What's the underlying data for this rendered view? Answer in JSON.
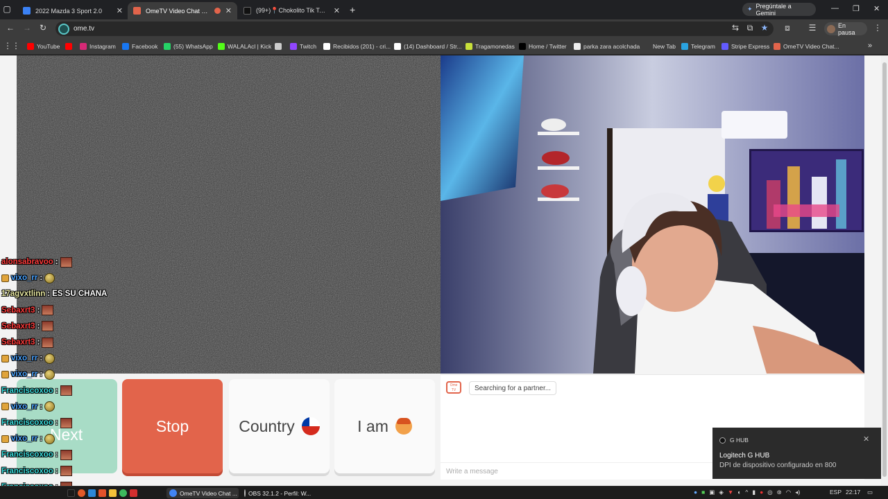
{
  "tabs": [
    {
      "title": "2022 Mazda 3 Sport 2.0",
      "color": "#3b82f6",
      "active": false
    },
    {
      "title": "OmeTV Video Chat — Ome",
      "color": "#e2644b",
      "active": true
    },
    {
      "title": "(99+)📍Chokolito Tik Tok 📍 c",
      "color": "#111111",
      "active": false
    }
  ],
  "browser": {
    "new_tab": "+",
    "gemini_label": "Pregúntale a Gemini",
    "url": "ome.tv",
    "profile_label": "En pausa",
    "back_icon": "←",
    "forward_icon": "→",
    "reload_icon": "↻",
    "menu_icon": "⋮"
  },
  "bookmarks": [
    {
      "label": "YouTube",
      "color": "#ff0000"
    },
    {
      "label": "",
      "color": "#ff0000"
    },
    {
      "label": "Instagram",
      "color": "#d62976"
    },
    {
      "label": "Facebook",
      "color": "#1877f2"
    },
    {
      "label": "(55) WhatsApp",
      "color": "#25d366"
    },
    {
      "label": "WALALAcl | Kick",
      "color": "#53fc18"
    },
    {
      "label": "",
      "color": "#cccccc"
    },
    {
      "label": "Twitch",
      "color": "#9146ff"
    },
    {
      "label": "Recibidos (201) - cri...",
      "color": "#ffffff"
    },
    {
      "label": "(14) Dashboard / Str...",
      "color": "#ffffff"
    },
    {
      "label": "Tragamonedas",
      "color": "#c8e03a"
    },
    {
      "label": "Home / Twitter",
      "color": "#000000"
    },
    {
      "label": "parka zara acolchada",
      "color": "#eeeeee"
    },
    {
      "label": "New Tab",
      "color": "#3c3c3c"
    },
    {
      "label": "Telegram",
      "color": "#2aa3e0"
    },
    {
      "label": "Stripe Express",
      "color": "#635bff"
    },
    {
      "label": "OmeTV Video Chat...",
      "color": "#e2644b"
    }
  ],
  "bookmarks_more": "»",
  "controls": {
    "next": "Next",
    "stop": "Stop",
    "country": "Country",
    "iam": "I am"
  },
  "chat": {
    "logo": "Ome TV",
    "searching": "Searching for a partner...",
    "placeholder": "Write a message"
  },
  "overlay_chat": [
    {
      "user": "alonsabravoo",
      "color": "#ff3b3b",
      "badge": false,
      "emote": "face",
      "text": ""
    },
    {
      "user": "vixo_rr",
      "color": "#4aa3ff",
      "badge": true,
      "emote": "coin",
      "text": ""
    },
    {
      "user": "17agvxtlinn",
      "color": "#e6e6a0",
      "badge": false,
      "emote": "",
      "text": "ES SU CHANA"
    },
    {
      "user": "Sebaxrt3",
      "color": "#ff3b3b",
      "badge": false,
      "emote": "face",
      "text": ""
    },
    {
      "user": "Sebaxrt3",
      "color": "#ff3b3b",
      "badge": false,
      "emote": "face",
      "text": ""
    },
    {
      "user": "Sebaxrt3",
      "color": "#ff3b3b",
      "badge": false,
      "emote": "face",
      "text": ""
    },
    {
      "user": "vixo_rr",
      "color": "#4aa3ff",
      "badge": true,
      "emote": "coin",
      "text": ""
    },
    {
      "user": "vixo_rr",
      "color": "#4aa3ff",
      "badge": true,
      "emote": "coin",
      "text": ""
    },
    {
      "user": "Franciscoxoo",
      "color": "#38d9d9",
      "badge": false,
      "emote": "face",
      "text": ""
    },
    {
      "user": "vixo_rr",
      "color": "#4aa3ff",
      "badge": true,
      "emote": "coin",
      "text": ""
    },
    {
      "user": "Franciscoxoo",
      "color": "#38d9d9",
      "badge": false,
      "emote": "face",
      "text": ""
    },
    {
      "user": "vixo_rr",
      "color": "#4aa3ff",
      "badge": true,
      "emote": "coin",
      "text": ""
    },
    {
      "user": "Franciscoxoo",
      "color": "#38d9d9",
      "badge": false,
      "emote": "face",
      "text": ""
    },
    {
      "user": "Franciscoxoo",
      "color": "#38d9d9",
      "badge": false,
      "emote": "face",
      "text": ""
    },
    {
      "user": "Franciscoxoo",
      "color": "#38d9d9",
      "badge": false,
      "emote": "face",
      "text": ""
    }
  ],
  "notification": {
    "app": "G HUB",
    "title": "Logitech G HUB",
    "body": "DPI de dispositivo configurado en 800",
    "close": "✕"
  },
  "taskbar": {
    "apps": [
      {
        "label": "OmeTV Video Chat ...",
        "color": "#4285f4"
      },
      {
        "label": "OBS 32.1.2 - Perfil: W...",
        "color": "#302e31"
      }
    ],
    "lang": "ESP",
    "time": "22:17"
  }
}
